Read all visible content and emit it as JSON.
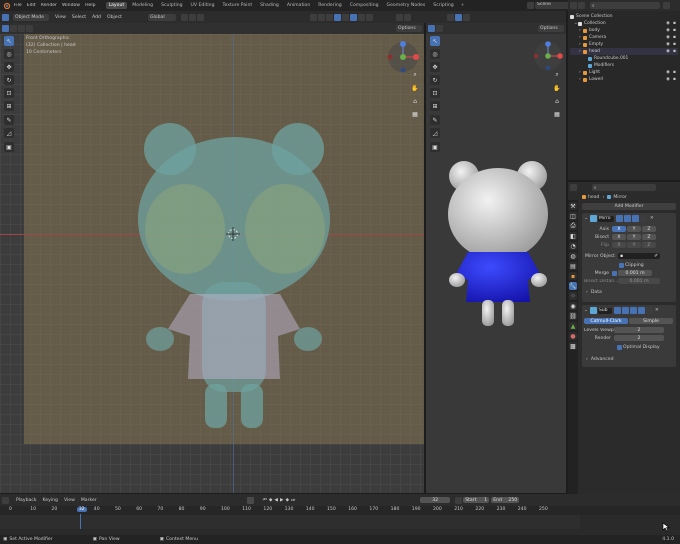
{
  "topbar": {
    "menus": [
      "File",
      "Edit",
      "Render",
      "Window",
      "Help"
    ],
    "workspaces": [
      "Layout",
      "Modeling",
      "Sculpting",
      "UV Editing",
      "Texture Paint",
      "Shading",
      "Animation",
      "Rendering",
      "Compositing",
      "Geometry Nodes",
      "Scripting"
    ],
    "active_workspace": "Layout",
    "scene": "Scene",
    "view_layer": "ViewLayer"
  },
  "viewport_header": {
    "mode": "Object Mode",
    "menus": [
      "View",
      "Select",
      "Add",
      "Object"
    ],
    "orientation": "Global",
    "options": "Options"
  },
  "viewport_info": {
    "view_name": "Front Orthographic",
    "collection": "(32) Collection | head",
    "units": "10 Centimeters"
  },
  "viewport2": {
    "options": "Options"
  },
  "outliner": {
    "title": "Scene Collection",
    "items": [
      {
        "label": "Collection",
        "indent": 0,
        "color": "#e0e0e0"
      },
      {
        "label": "body",
        "indent": 1,
        "color": "#e69a3c"
      },
      {
        "label": "Camera",
        "indent": 1,
        "color": "#e69a3c"
      },
      {
        "label": "Empty",
        "indent": 1,
        "color": "#e69a3c"
      },
      {
        "label": "head",
        "indent": 1,
        "color": "#e69a3c"
      },
      {
        "label": "Roundcube.001",
        "indent": 2,
        "color": "#5ea8d8"
      },
      {
        "label": "Modifiers",
        "indent": 2,
        "color": "#5ea8d8"
      },
      {
        "label": "Light",
        "indent": 1,
        "color": "#e69a3c"
      },
      {
        "label": "Lowerl",
        "indent": 1,
        "color": "#e69a3c"
      }
    ]
  },
  "properties": {
    "object_name": "head",
    "modifier_name": "Mirror",
    "add_modifier": "Add Modifier",
    "mirror": {
      "name": "Mirro",
      "axis_label": "Axis",
      "bisect_label": "Bisect",
      "flip_label": "Flip",
      "axes": [
        "X",
        "Y",
        "Z"
      ],
      "mirror_object_label": "Mirror Object",
      "clipping": "Clipping",
      "merge_label": "Merge",
      "merge_value": "0.001 m",
      "bisect_distance_label": "Bisect Distan...",
      "bisect_distance_value": "0.001 m",
      "data_label": "Data"
    },
    "subsurf": {
      "name": "Sub",
      "catmull": "Catmull-Clark",
      "simple": "Simple",
      "levels_viewport_label": "Levels Viewp...",
      "levels_viewport": "2",
      "render_label": "Render",
      "render_value": "2",
      "optimal_display": "Optimal Display",
      "advanced": "Advanced"
    }
  },
  "timeline": {
    "menus": [
      "Playback",
      "Keying",
      "View",
      "Marker"
    ],
    "current_frame": "32",
    "start_label": "Start",
    "start": "1",
    "end_label": "End",
    "end": "250",
    "ticks": [
      "0",
      "10",
      "20",
      "32",
      "40",
      "50",
      "60",
      "70",
      "80",
      "90",
      "100",
      "110",
      "120",
      "130",
      "140",
      "150",
      "160",
      "170",
      "180",
      "190",
      "200",
      "210",
      "220",
      "230",
      "240",
      "250"
    ]
  },
  "statusbar": {
    "left": "Set Active Modifier",
    "middle": "Pan View",
    "right": "Context Menu",
    "version": "4.1.0"
  }
}
